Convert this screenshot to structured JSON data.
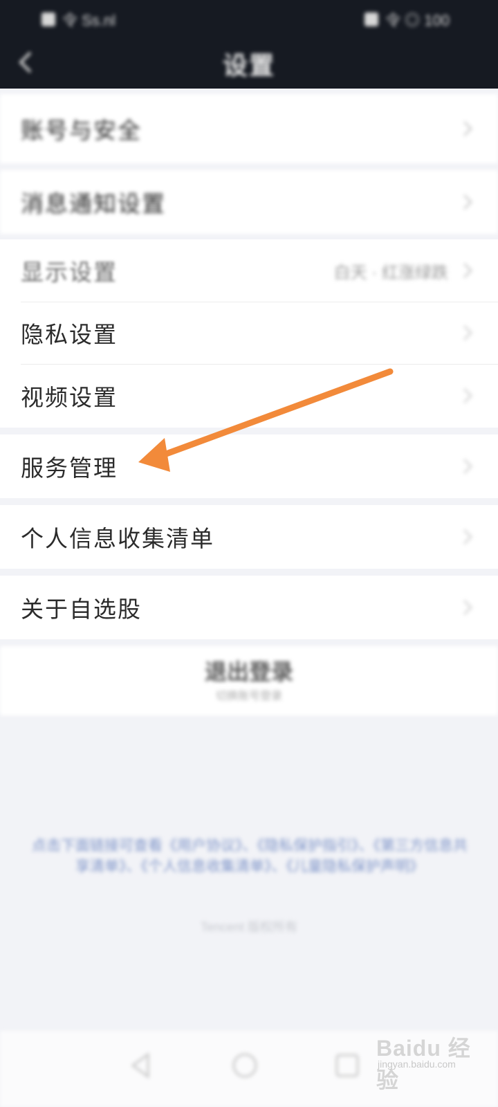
{
  "status_bar": {
    "left_text": "令 Ss.nl",
    "right_text": "令 ◎ 100"
  },
  "header": {
    "title": "设置"
  },
  "groups": [
    {
      "items": [
        {
          "label": "账号与安全"
        }
      ]
    },
    {
      "items": [
        {
          "label": "消息通知设置"
        }
      ]
    },
    {
      "items": [
        {
          "label": "显示设置",
          "value": "白天 · 红涨绿跌"
        },
        {
          "label": "隐私设置"
        },
        {
          "label": "视频设置"
        }
      ]
    },
    {
      "items": [
        {
          "label": "服务管理"
        }
      ]
    },
    {
      "items": [
        {
          "label": "个人信息收集清单"
        }
      ]
    },
    {
      "items": [
        {
          "label": "关于自选股"
        }
      ]
    }
  ],
  "footer": {
    "logout_label": "退出登录",
    "logout_sub": "切换账号登录",
    "legal_text": "点击下面链接可查看《用户协议》、《隐私保护指引》、《第三方信息共享清单》、《个人信息收集清单》、《儿童隐私保护声明》",
    "copyright": "Tencent 版权所有"
  },
  "annotation": {
    "arrow_color": "#f28a3a"
  },
  "watermark": {
    "main": "Baidu 经验",
    "sub": "jingyan.baidu.com"
  }
}
